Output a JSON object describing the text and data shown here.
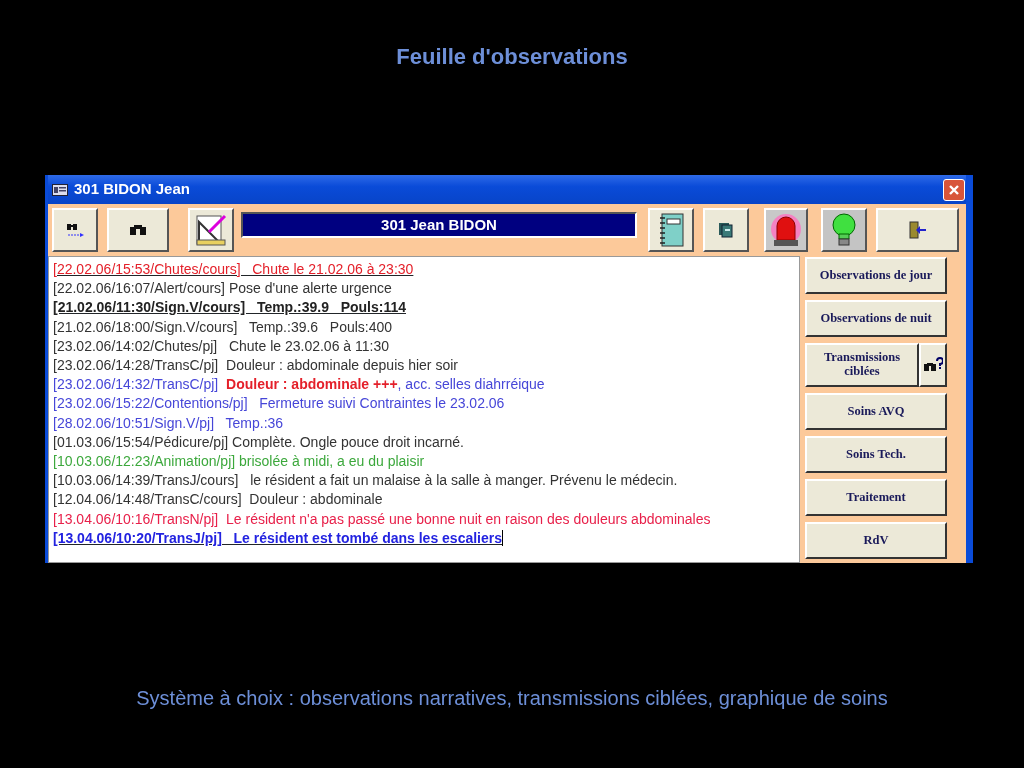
{
  "slide_title": "Feuille d'observations",
  "window": {
    "title": "301  BIDON Jean",
    "patient_banner": "301  Jean BIDON"
  },
  "log_entries": [
    {
      "underline": true,
      "cursor": false,
      "segments": [
        {
          "text": "[22.02.06/15:53/Chutes/cours]   Chute le 21.02.06 à 23:30",
          "color": "#e4202a",
          "bold": false
        }
      ]
    },
    {
      "underline": false,
      "cursor": false,
      "segments": [
        {
          "text": "[22.02.06/16:07/Alert/cours] Pose d'une alerte urgence",
          "color": "#333333",
          "bold": false
        }
      ]
    },
    {
      "underline": true,
      "cursor": false,
      "segments": [
        {
          "text": "[21.02.06/11:30/Sign.V/cours]   Temp.:39.9   Pouls:114",
          "color": "#222222",
          "bold": true
        }
      ]
    },
    {
      "underline": false,
      "cursor": false,
      "segments": [
        {
          "text": "[21.02.06/18:00/Sign.V/cours]   Temp.:39.6   Pouls:400",
          "color": "#333333",
          "bold": false
        }
      ]
    },
    {
      "underline": false,
      "cursor": false,
      "segments": [
        {
          "text": "[23.02.06/14:02/Chutes/pj]   Chute le 23.02.06 à 11:30",
          "color": "#333333",
          "bold": false
        }
      ]
    },
    {
      "underline": false,
      "cursor": false,
      "segments": [
        {
          "text": "[23.02.06/14:28/TransC/pj]  Douleur : abdominale depuis hier soir",
          "color": "#333333",
          "bold": false
        }
      ]
    },
    {
      "underline": false,
      "cursor": false,
      "segments": [
        {
          "text": "[23.02.06/14:32/TransC/pj]  ",
          "color": "#4646d8",
          "bold": false
        },
        {
          "text": "Douleur : abdominale +++",
          "color": "#e4202a",
          "bold": true
        },
        {
          "text": ", acc. selles diahrréique",
          "color": "#4646d8",
          "bold": false
        }
      ]
    },
    {
      "underline": false,
      "cursor": false,
      "segments": [
        {
          "text": "[23.02.06/15:22/Contentions/pj]   Fermeture suivi Contraintes le 23.02.06",
          "color": "#4646d8",
          "bold": false
        }
      ]
    },
    {
      "underline": false,
      "cursor": false,
      "segments": [
        {
          "text": "[28.02.06/10:51/Sign.V/pj]   Temp.:36",
          "color": "#4646d8",
          "bold": false
        }
      ]
    },
    {
      "underline": false,
      "cursor": false,
      "segments": [
        {
          "text": "[01.03.06/15:54/Pédicure/pj] Complète. Ongle pouce droit incarné.",
          "color": "#333333",
          "bold": false
        }
      ]
    },
    {
      "underline": false,
      "cursor": false,
      "segments": [
        {
          "text": "[10.03.06/12:23/Animation/pj] brisolée à midi, a eu du plaisir",
          "color": "#3ca83c",
          "bold": false
        }
      ]
    },
    {
      "underline": false,
      "cursor": false,
      "segments": [
        {
          "text": "[10.03.06/14:39/TransJ/cours]   le résident a fait un malaise à la salle à manger. Prévenu le médecin.",
          "color": "#333333",
          "bold": false
        }
      ]
    },
    {
      "underline": false,
      "cursor": false,
      "segments": [
        {
          "text": "[12.04.06/14:48/TransC/cours]  Douleur : abdominale",
          "color": "#333333",
          "bold": false
        }
      ]
    },
    {
      "underline": false,
      "cursor": false,
      "segments": [
        {
          "text": "[13.04.06/10:16/TransN/pj]  Le résident n'a pas passé une bonne nuit en raison des douleurs abdominales",
          "color": "#e8204a",
          "bold": false
        }
      ]
    },
    {
      "underline": true,
      "cursor": true,
      "segments": [
        {
          "text": "[13.04.06/10:20/TransJ/pj]   Le résident est tombé dans les escaliers",
          "color": "#2222e0",
          "bold": true
        }
      ]
    }
  ],
  "side_buttons": [
    {
      "kind": "plain",
      "label": "Observations de jour"
    },
    {
      "kind": "plain",
      "label": "Observations de nuit"
    },
    {
      "kind": "split",
      "label": "Transmissions ciblées"
    },
    {
      "kind": "plain",
      "label": "Soins AVQ"
    },
    {
      "kind": "plain",
      "label": "Soins Tech."
    },
    {
      "kind": "plain",
      "label": "Traitement"
    },
    {
      "kind": "plain",
      "label": "RdV"
    }
  ],
  "caption": "Système à choix : observations narratives, transmissions ciblées, graphique de soins"
}
